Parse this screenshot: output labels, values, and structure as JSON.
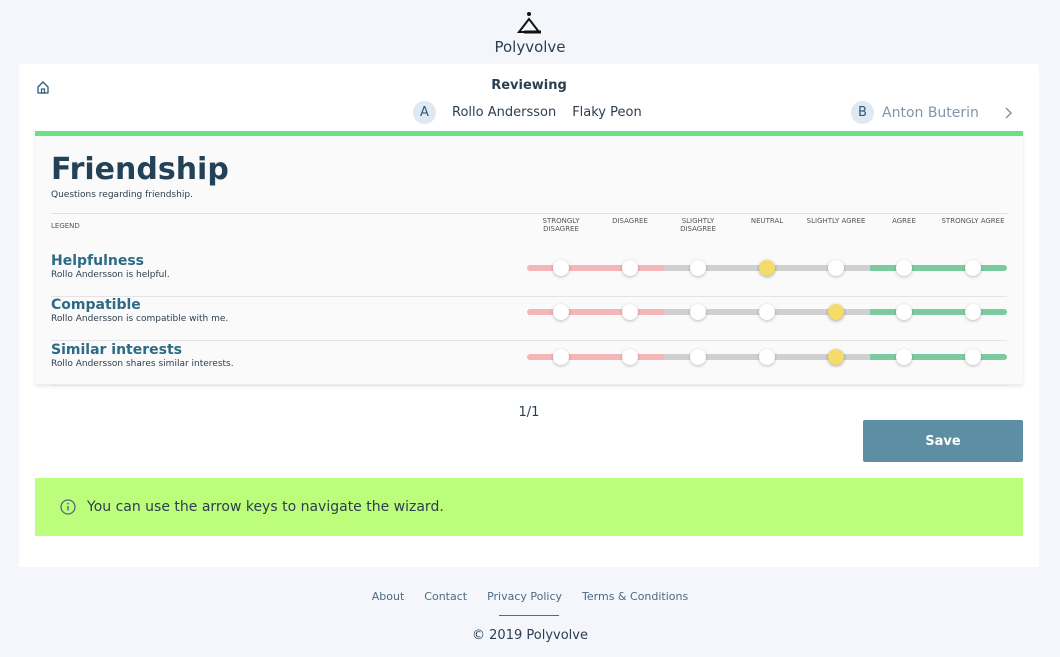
{
  "brand": {
    "name": "Polyvolve",
    "logo_icon": "polyvolve-logo-icon"
  },
  "header": {
    "reviewing_label": "Reviewing",
    "reviewer": {
      "letter": "A",
      "name": "Rollo Andersson",
      "team": "Flaky Peon"
    },
    "reviewee": {
      "letter": "B",
      "name": "Anton Buterin"
    }
  },
  "section": {
    "title": "Friendship",
    "subtitle": "Questions regarding friendship.",
    "legend_label": "LEGEND",
    "scale": [
      "STRONGLY DISAGREE",
      "DISAGREE",
      "SLIGHTLY DISAGREE",
      "NEUTRAL",
      "SLIGHTLY AGREE",
      "AGREE",
      "STRONGLY AGREE"
    ],
    "questions": [
      {
        "title": "Helpfulness",
        "description": "Rollo Andersson is helpful.",
        "selected_index": 3
      },
      {
        "title": "Compatible",
        "description": "Rollo Andersson is compatible with me.",
        "selected_index": 4
      },
      {
        "title": "Similar interests",
        "description": "Rollo Andersson shares similar interests.",
        "selected_index": 4
      }
    ]
  },
  "pager": "1/1",
  "save_label": "Save",
  "tip": "You can use the arrow keys to navigate the wizard.",
  "footer": {
    "links": [
      "About",
      "Contact",
      "Privacy Policy",
      "Terms & Conditions"
    ],
    "copyright": "© 2019 Polyvolve"
  },
  "colors": {
    "accent": "#5e8ea4",
    "panel_top": "#6fe07f",
    "tip_bg": "#bcfd7c",
    "disagree": "#f4b6b6",
    "neutral": "#d0d0d0",
    "agree": "#7ccba0",
    "selected": "#f5dc68"
  }
}
